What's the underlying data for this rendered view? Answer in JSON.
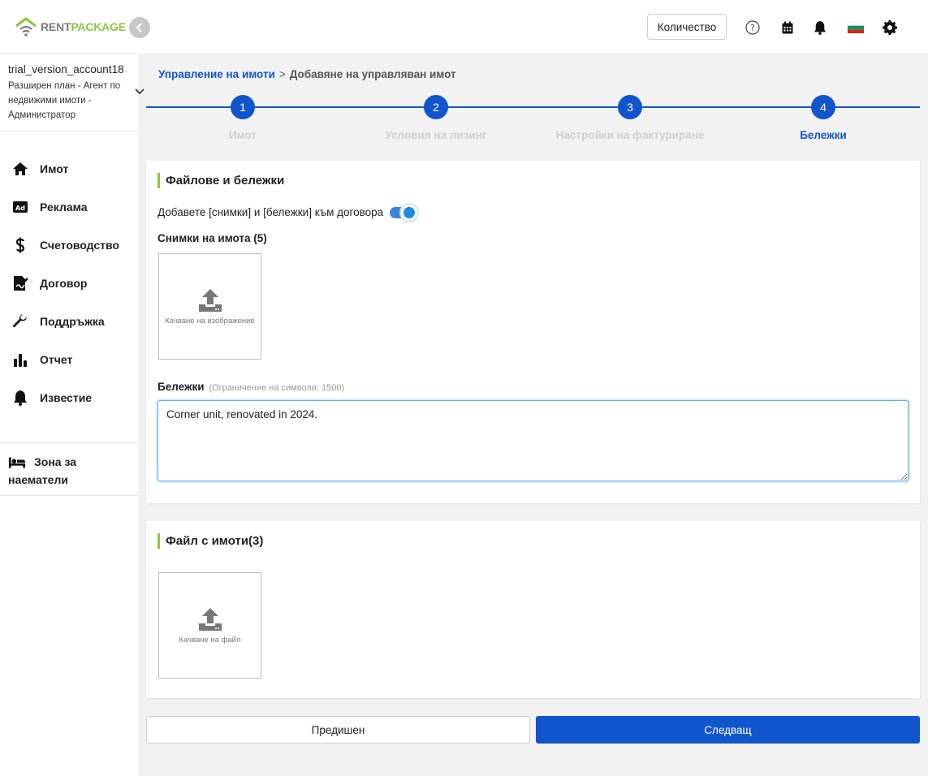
{
  "brand": {
    "part1": "RENT",
    "part2": "PACKAGE",
    "accent": "#8cc63f",
    "primary": "#1155cc"
  },
  "account": {
    "name": "trial_version_account18",
    "plan": "Разширен план - Агент по недвижими имоти - Администратор"
  },
  "nav": [
    {
      "label": "Имот",
      "icon": "home-icon"
    },
    {
      "label": "Реклама",
      "icon": "ad-icon"
    },
    {
      "label": "Счетоводство",
      "icon": "dollar-icon"
    },
    {
      "label": "Договор",
      "icon": "contract-icon"
    },
    {
      "label": "Поддръжка",
      "icon": "wrench-icon"
    },
    {
      "label": "Отчет",
      "icon": "chart-icon"
    },
    {
      "label": "Известие",
      "icon": "bell-icon"
    }
  ],
  "tenant_zone": {
    "label": "Зона за наематели",
    "icon": "bed-icon"
  },
  "header": {
    "quantity_button": "Количество"
  },
  "breadcrumb": {
    "root": "Управление на имоти",
    "separator": ">",
    "current": "Добавяне на управляван имот"
  },
  "stepper": {
    "steps": [
      {
        "number": "1",
        "label": "Имот"
      },
      {
        "number": "2",
        "label": "Условия на лизинг"
      },
      {
        "number": "3",
        "label": "Настройки на фактуриране"
      },
      {
        "number": "4",
        "label": "Бележки"
      }
    ],
    "active": 4
  },
  "files_notes": {
    "title": "Файлове и бележки",
    "toggle_label": "Добавете [снимки] и [бележки] към договора",
    "toggle_on": true,
    "photos_label": "Снимки на имота (5)",
    "upload_image": "Качване на изображение",
    "notes_label": "Бележки",
    "notes_limit": "(Ограничение на символи: 1500)",
    "notes_value": "Corner unit, renovated in 2024."
  },
  "property_files": {
    "title": "Файл с имоти(3)",
    "upload_file": "Качване на файл"
  },
  "buttons": {
    "previous": "Предишен",
    "next": "Следващ"
  }
}
